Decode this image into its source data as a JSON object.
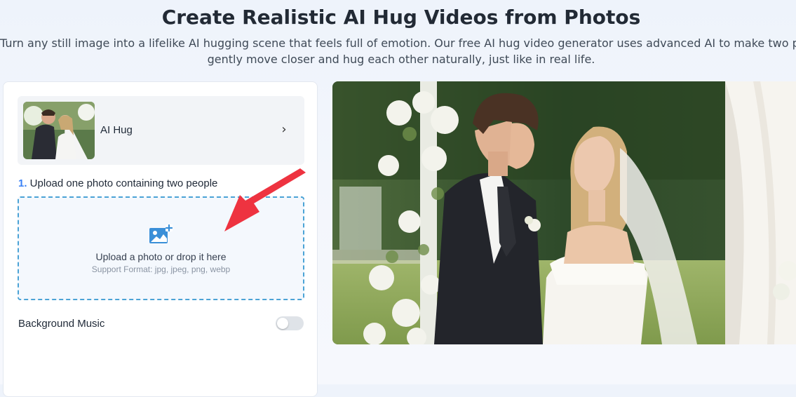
{
  "header": {
    "title": "Create Realistic AI Hug Videos from Photos",
    "subtitle_line1": "Turn any still image into a lifelike AI hugging scene that feels full of emotion. Our free AI hug video generator uses advanced AI to make two people",
    "subtitle_line2": "gently move closer and hug each other naturally, just like in real life."
  },
  "template": {
    "label": "AI Hug",
    "chevron": "›"
  },
  "upload": {
    "step_number": "1.",
    "step_text": " Upload one photo containing two people",
    "drop_main": "Upload a photo or drop it here",
    "drop_sub": "Support Format: jpg, jpeg, png, webp",
    "icon": "image-plus-icon"
  },
  "music": {
    "label": "Background Music",
    "enabled": false
  },
  "colors": {
    "accent": "#3b82f6",
    "dashed_border": "#4ba3d6",
    "annotation_arrow": "#ee3340"
  }
}
